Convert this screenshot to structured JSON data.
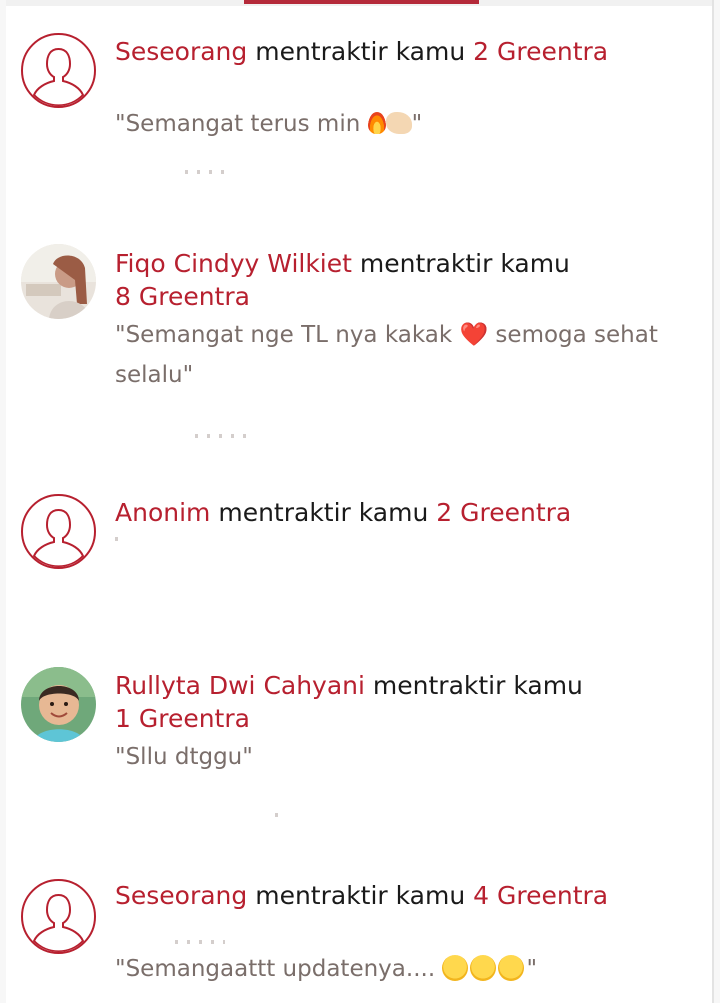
{
  "notifications": [
    {
      "name": "Seseorang",
      "action": " mentraktir kamu ",
      "amount": "2 Greentra",
      "message_prefix": "\"Semangat terus min ",
      "emoji1": "fire-emoji",
      "emoji2": "flexed-biceps-emoji",
      "message_suffix": "\"",
      "avatar": "default-user-icon"
    },
    {
      "name": "Fiqo Cindyy Wilkiet",
      "action": " mentraktir kamu",
      "amount": "8 Greentra",
      "message_prefix": "\"Semangat nge TL nya kakak ",
      "emoji1": "❤️",
      "message_suffix": " semoga sehat selalu\"",
      "avatar": "profile-photo"
    },
    {
      "name": "Anonim",
      "action": " mentraktir kamu ",
      "amount": "2 Greentra",
      "message_prefix": "",
      "avatar": "default-user-icon"
    },
    {
      "name": "Rullyta Dwi Cahyani",
      "action": " mentraktir kamu",
      "amount": "1 Greentra",
      "message_prefix": "\"Sllu dtggu\"",
      "avatar": "profile-photo"
    },
    {
      "name": "Seseorang",
      "action": " mentraktir kamu ",
      "amount": "4 Greentra",
      "message_prefix": "\"Semangaattt updatenya.... ",
      "emoji1": "hugging-face-emoji",
      "message_suffix": "\"",
      "avatar": "default-user-icon"
    }
  ],
  "colors": {
    "accent": "#b7202f",
    "text": "#1a1a1a",
    "message": "#7a6e6a"
  }
}
